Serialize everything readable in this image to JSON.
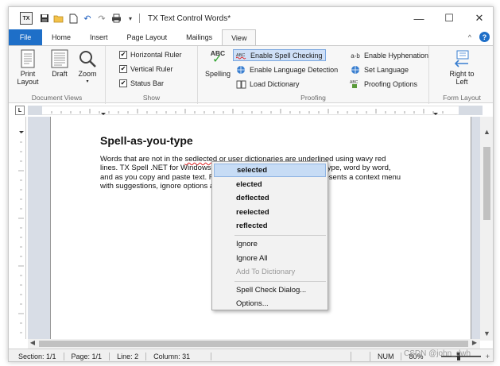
{
  "window": {
    "title": "TX Text Control Words*",
    "app_icon": "TX",
    "controls": {
      "minimize": "—",
      "maximize": "☐",
      "close": "✕"
    }
  },
  "quick_access": [
    "save-icon",
    "open-folder-icon",
    "new-document-icon",
    "undo-icon",
    "redo-icon",
    "print-icon",
    "customize-icon"
  ],
  "tabs": [
    {
      "label": "File"
    },
    {
      "label": "Home"
    },
    {
      "label": "Insert"
    },
    {
      "label": "Page Layout"
    },
    {
      "label": "Mailings"
    },
    {
      "label": "View"
    }
  ],
  "tab_right": {
    "collapse": "^",
    "help": "?"
  },
  "ribbon": {
    "document_views": {
      "label": "Document Views",
      "print_layout": "Print Layout",
      "draft": "Draft",
      "zoom": "Zoom"
    },
    "show": {
      "label": "Show",
      "horizontal_ruler": "Horizontal Ruler",
      "vertical_ruler": "Vertical Ruler",
      "status_bar": "Status Bar"
    },
    "proofing": {
      "label": "Proofing",
      "spelling": "Spelling",
      "spelling_icon_text": "ABC",
      "enable_spell_checking": "Enable Spell Checking",
      "enable_language_detection": "Enable Language Detection",
      "load_dictionary": "Load Dictionary",
      "enable_hyphenation": "Enable Hyphenation",
      "set_language": "Set Language",
      "proofing_options": "Proofing Options"
    },
    "form_layout": {
      "label": "Form Layout",
      "right_to_left": "Right to Left"
    }
  },
  "document": {
    "heading": "Spell-as-you-type",
    "p1_before": "Words that are not in the ",
    "misspelled": "sedlected",
    "p1_after": " or user dictionaries are underlined using wavy red lines. TX Spell .NET for Windows Forms checks for spelling as you type, word by word, and as you copy and paste text. Right-clicking a spelling mistake presents a context menu with suggestions, ignore options and add to user dictionary."
  },
  "context_menu": {
    "suggestions": [
      "selected",
      "elected",
      "deflected",
      "reelected",
      "reflected"
    ],
    "ignore": "Ignore",
    "ignore_all": "Ignore All",
    "add_to_dictionary": "Add To Dictionary",
    "spell_check_dialog": "Spell Check Dialog...",
    "options": "Options..."
  },
  "status_bar": {
    "section": "Section: 1/1",
    "page": "Page: 1/1",
    "line": "Line: 2",
    "column": "Column: 31",
    "num": "NUM",
    "zoom": "80%",
    "zoom_minus": "−",
    "zoom_plus": "+"
  },
  "watermark": "CSDN @john_dwh",
  "colors": {
    "file_tab": "#1e6fc8",
    "misspell_underline": "#e02020",
    "menu_highlight": "#c7dcf5"
  }
}
